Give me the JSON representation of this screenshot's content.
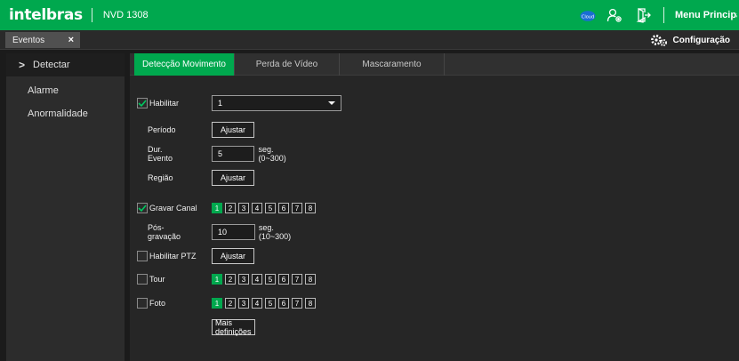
{
  "header": {
    "logo": "intelbras",
    "model": "NVD 1308",
    "main_menu": "Menu Principal",
    "cloud_badge": "Cloud",
    "icons": [
      "cloud-icon",
      "user-settings-icon",
      "logout-icon"
    ]
  },
  "tabbar": {
    "tab_label": "Eventos",
    "close": "×",
    "config_label": "Configuração"
  },
  "sidebar": {
    "items": [
      {
        "label": "Detectar",
        "arrow": ">"
      },
      {
        "label": "Alarme"
      },
      {
        "label": "Anormalidade"
      }
    ]
  },
  "subtabs": [
    "Detecção Movimento",
    "Perda de Vídeo",
    "Mascaramento"
  ],
  "form": {
    "habilitar": {
      "label": "Habilitar",
      "checked": true
    },
    "channel_select": {
      "value": "1"
    },
    "periodo": {
      "label": "Período",
      "button": "Ajustar"
    },
    "dur_evento": {
      "label": "Dur. Evento",
      "value": "5",
      "suffix": "seg.(0~300)"
    },
    "regiao": {
      "label": "Região",
      "button": "Ajustar"
    },
    "gravar_canal": {
      "label": "Gravar Canal",
      "checked": true
    },
    "pos_gravacao": {
      "label": "Pós-gravação",
      "value": "10",
      "suffix": "seg.(10~300)"
    },
    "habilitar_ptz": {
      "label": "Habilitar PTZ",
      "checked": false,
      "button": "Ajustar"
    },
    "tour": {
      "label": "Tour",
      "checked": false
    },
    "foto": {
      "label": "Foto",
      "checked": false
    },
    "mais": {
      "button": "Mais definições"
    },
    "channels": [
      "1",
      "2",
      "3",
      "4",
      "5",
      "6",
      "7",
      "8"
    ],
    "selected_channel": "1"
  },
  "colors": {
    "accent": "#00a84e",
    "background": "#1b1b1b",
    "panel": "#262626"
  }
}
